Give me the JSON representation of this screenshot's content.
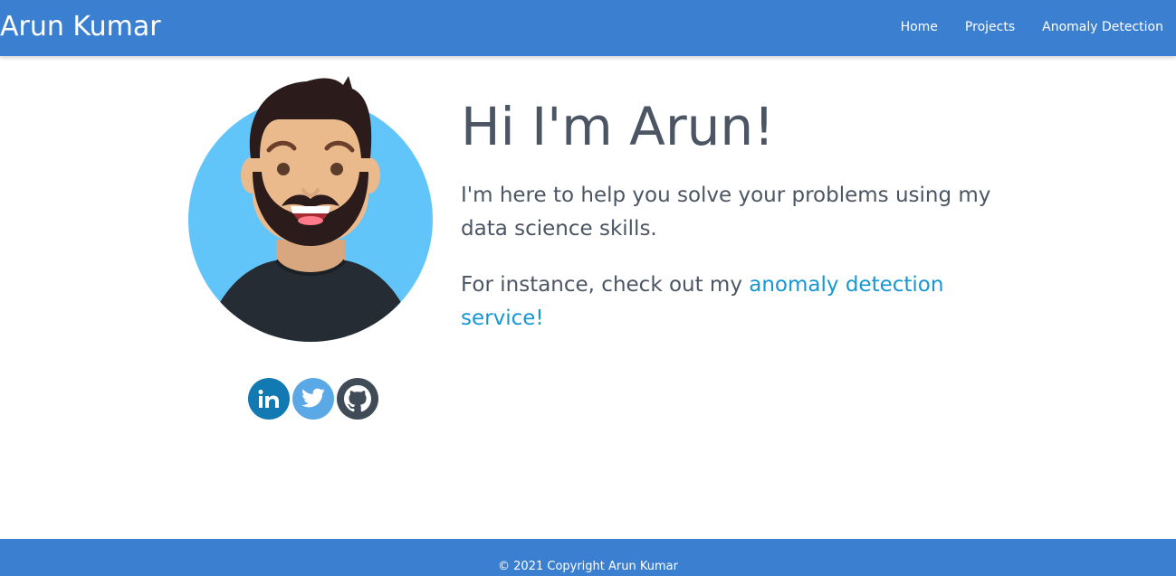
{
  "navbar": {
    "brand": "Arun Kumar",
    "links": [
      "Home",
      "Projects",
      "Anomaly Detection"
    ]
  },
  "hero": {
    "title": "Hi I'm Arun!",
    "paragraph1": "I'm here to help you solve your problems using my data science skills.",
    "paragraph2_prefix": "For instance, check out my ",
    "paragraph2_link": "anomaly detection service!"
  },
  "socials": {
    "icons": [
      "linkedin-icon",
      "twitter-icon",
      "github-icon"
    ],
    "linkedin_text": "in"
  },
  "footer": {
    "text": "© 2021 Copyright Arun Kumar"
  },
  "colors": {
    "navbar_bg": "#3b7fd0",
    "text": "#4b5563",
    "link": "#1796d4",
    "avatar_bg": "#62c5fa",
    "linkedin": "#1279b3",
    "twitter": "#5aa9e6",
    "github": "#3f4b56"
  }
}
